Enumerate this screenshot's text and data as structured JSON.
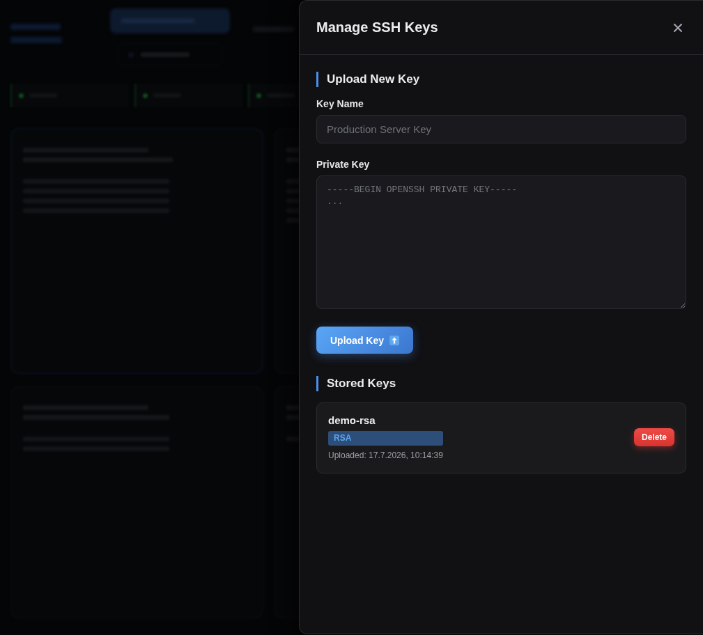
{
  "dialog": {
    "title": "Manage SSH Keys"
  },
  "upload_section": {
    "heading": "Upload New Key",
    "fields": [
      {
        "kind": "input",
        "label": "Key Name",
        "placeholder": "Production Server Key"
      },
      {
        "kind": "textarea",
        "label": "Private Key",
        "placeholder": "-----BEGIN OPENSSH PRIVATE KEY-----\n..."
      }
    ],
    "submit": "Upload Key"
  },
  "stored_section": {
    "heading": "Stored Keys",
    "keys": [
      {
        "name": "demo-rsa",
        "type": "RSA",
        "uploaded": "Uploaded: 17.7.2026, 10:14:39",
        "action": "Delete"
      }
    ]
  }
}
